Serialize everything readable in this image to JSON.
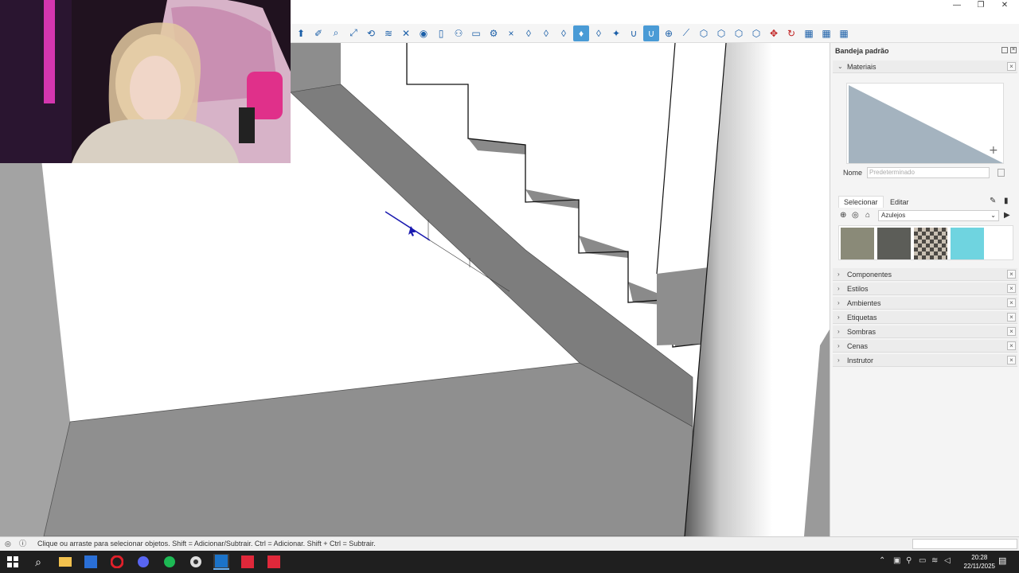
{
  "window": {
    "minimize_glyph": "—",
    "maximize_glyph": "❐",
    "close_glyph": "✕"
  },
  "toolbar": {
    "tools": [
      "select-icon",
      "eraser-icon",
      "zoom-icon",
      "zoom-extents-icon",
      "orbit-icon",
      "layers-icon",
      "section-icon",
      "user-icon",
      "new-page-icon",
      "person-icon",
      "folder-icon",
      "settings-icon",
      "close-icon",
      "drop-icon",
      "drop-icon",
      "drop-icon",
      "drop-fill-icon",
      "drop-icon",
      "sparkle-icon",
      "magnet-icon",
      "magnet-active-icon",
      "add-circle-icon",
      "measure-icon",
      "cube-icon",
      "cube-icon",
      "cube-icon",
      "cube-icon",
      "move-icon",
      "rotate-icon",
      "grid-icon",
      "grid-icon",
      "grid-icon"
    ]
  },
  "panel": {
    "title": "Bandeja padrão",
    "materials_header": "Materiais",
    "name_label": "Nome",
    "name_placeholder": "Predeterminado",
    "tab_select": "Selecionar",
    "tab_edit": "Editar",
    "category": "Azulejos",
    "sections": [
      "Componentes",
      "Estilos",
      "Ambientes",
      "Etiquetas",
      "Sombras",
      "Cenas",
      "Instrutor"
    ],
    "swatch_colors": [
      "#8a8a78",
      "#5c5d58",
      "#8f8477",
      "#6fd4e0"
    ]
  },
  "status": {
    "text": "Clique ou arraste para selecionar objetos. Shift = Adicionar/Subtrair. Ctrl = Adicionar. Shift + Ctrl = Subtrair."
  },
  "taskbar": {
    "time": "20:28",
    "date": "22/11/2025"
  },
  "colors": {
    "accent": "#4a9bd6",
    "floor": "#8f8f8f",
    "stair": "#7d7d7d"
  }
}
